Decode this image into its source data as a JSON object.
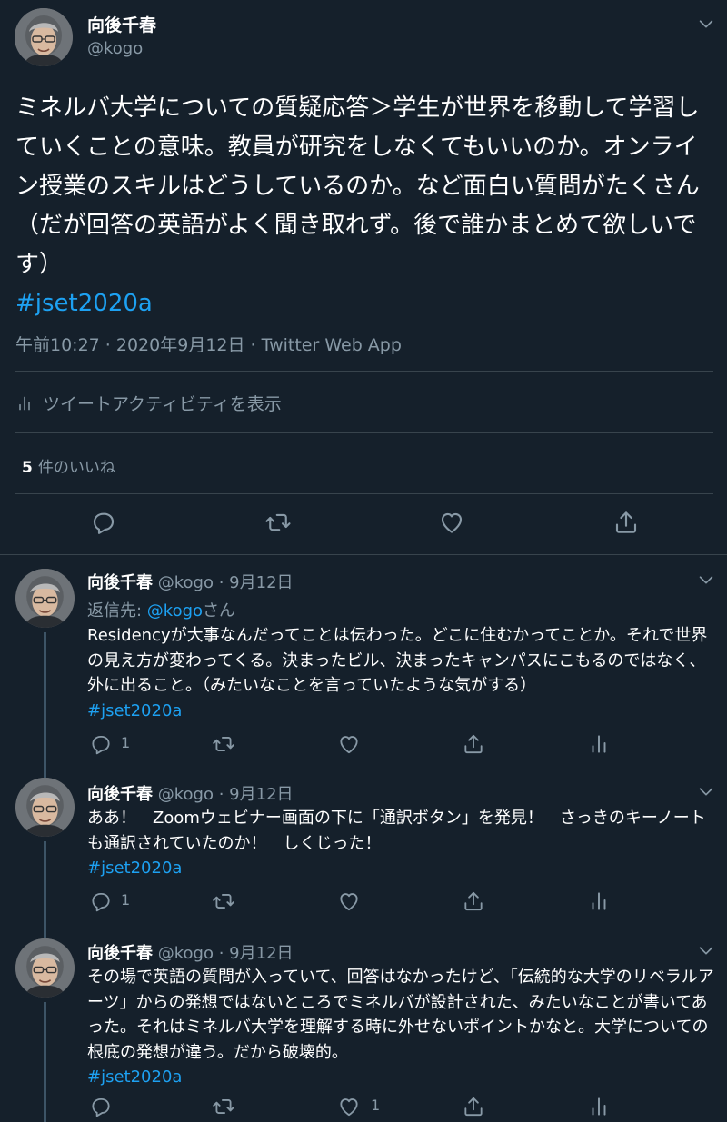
{
  "main_tweet": {
    "author_name": "向後千春",
    "author_handle": "@kogo",
    "text": "ミネルバ大学についての質疑応答＞学生が世界を移動して学習していくことの意味。教員が研究をしなくてもいいのか。オンライン授業のスキルはどうしているのか。など面白い質問がたくさん（だが回答の英語がよく聞き取れず。後で誰かまとめて欲しいです）",
    "hashtag": "#jset2020a",
    "meta": "午前10:27 · 2020年9月12日 · Twitter Web App",
    "activity_label": "ツイートアクティビティを表示",
    "likes_count": "5",
    "likes_label": "件のいいね",
    "action_icons": [
      "reply-icon",
      "retweet-icon",
      "like-icon",
      "share-icon"
    ]
  },
  "replies": [
    {
      "author_name": "向後千春",
      "author_handle": "@kogo",
      "date": "9月12日",
      "reply_to_prefix": "返信先: ",
      "reply_to_handle": "@kogo",
      "reply_to_suffix": "さん",
      "text": "Residencyが大事なんだってことは伝わった。どこに住むかってことか。それで世界の見え方が変わってくる。決まったビル、決まったキャンパスにこもるのではなく、外に出ること。（みたいなことを言っていたような気がする）",
      "hashtag": "#jset2020a",
      "reply_count": "1",
      "like_count": ""
    },
    {
      "author_name": "向後千春",
      "author_handle": "@kogo",
      "date": "9月12日",
      "text": "ああ！　Zoomウェビナー画面の下に「通訳ボタン」を発見！　さっきのキーノートも通訳されていたのか！　しくじった！",
      "hashtag": "#jset2020a",
      "reply_count": "1",
      "like_count": ""
    },
    {
      "author_name": "向後千春",
      "author_handle": "@kogo",
      "date": "9月12日",
      "text": "その場で英語の質問が入っていて、回答はなかったけど、「伝統的な大学のリベラルアーツ」からの発想ではないところでミネルバが設計された、みたいなことが書いてあった。それはミネルバ大学を理解する時に外せないポイントかなと。大学についての根底の発想が違う。だから破壊的。",
      "hashtag": "#jset2020a",
      "reply_count": "",
      "like_count": "1"
    }
  ],
  "colors": {
    "background": "#15202b",
    "text": "#ffffff",
    "muted": "#8899a6",
    "link": "#1da1f2",
    "divider": "#38444d"
  }
}
